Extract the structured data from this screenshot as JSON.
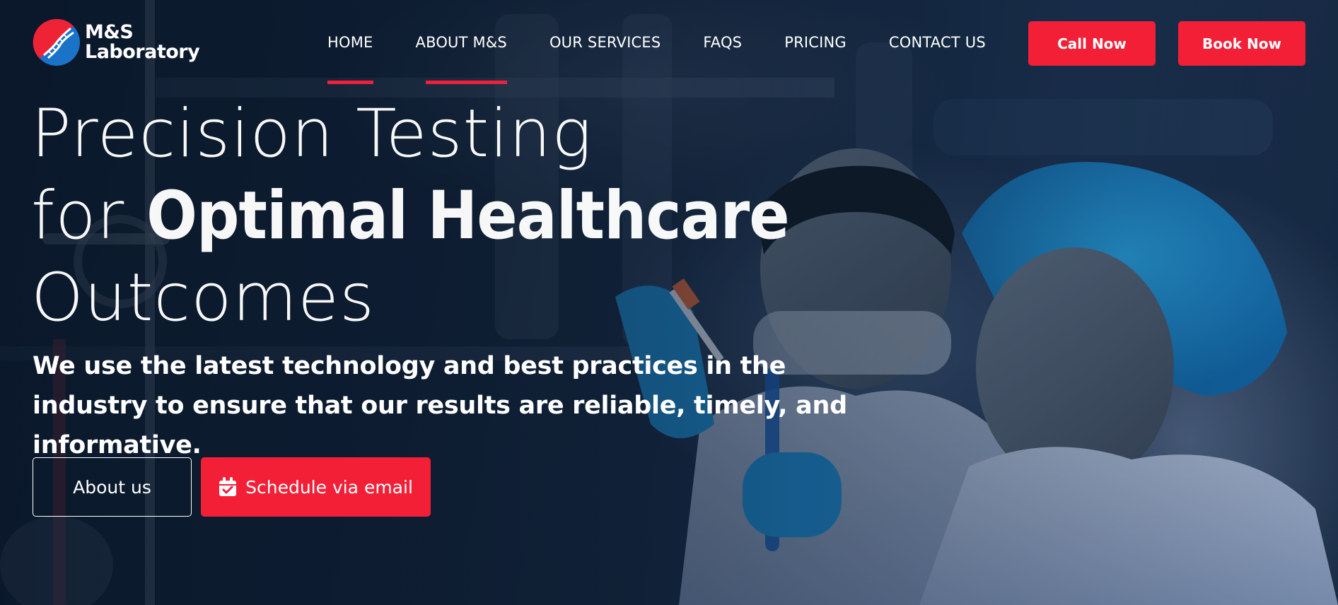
{
  "brand": {
    "name_line1": "M&S",
    "name_line2": "Laboratory",
    "logo_icon": "dna-helix-icon"
  },
  "nav": {
    "items": [
      {
        "label": "HOME",
        "active": true
      },
      {
        "label": "ABOUT M&S",
        "active": false
      },
      {
        "label": "OUR SERVICES",
        "active": false
      },
      {
        "label": "FAQS",
        "active": false
      },
      {
        "label": "PRICING",
        "active": false
      },
      {
        "label": "CONTACT US",
        "active": false
      }
    ]
  },
  "header_actions": {
    "call_label": "Call Now",
    "book_label": "Book Now"
  },
  "hero": {
    "line1": "Precision Testing",
    "line2_prefix": "for ",
    "line2_bold": "Optimal Healthcare",
    "line3": "Outcomes",
    "subtext_line1": "We use the latest technology and best practices in the",
    "subtext_line2": "industry to ensure that our results are reliable, timely, and informative.",
    "about_label": "About us",
    "schedule_label": "Schedule via email",
    "schedule_icon": "calendar-check-icon"
  },
  "colors": {
    "accent": "#f21f37",
    "background": "#14263d",
    "text": "#ffffff"
  }
}
